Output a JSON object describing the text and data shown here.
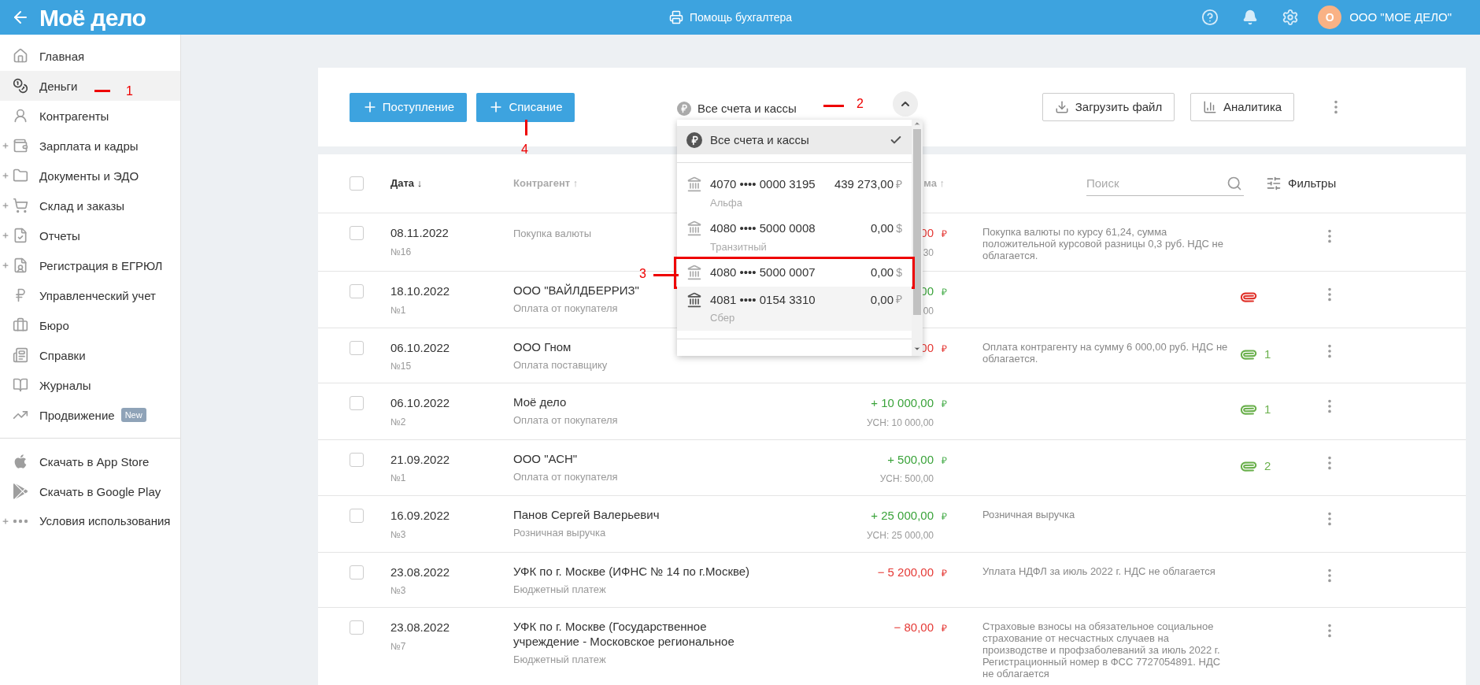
{
  "topbar": {
    "logo": "Моё дело",
    "center_link": "Помощь бухгалтера",
    "avatar_letter": "О",
    "company": "ООО \"МОЕ ДЕЛО\""
  },
  "sidebar": {
    "items": [
      {
        "label": "Главная",
        "selected": false,
        "expandable": false
      },
      {
        "label": "Деньги",
        "selected": true,
        "expandable": false
      },
      {
        "label": "Контрагенты",
        "selected": false,
        "expandable": false
      },
      {
        "label": "Зарплата и кадры",
        "selected": false,
        "expandable": true
      },
      {
        "label": "Документы и ЭДО",
        "selected": false,
        "expandable": true
      },
      {
        "label": "Склад и заказы",
        "selected": false,
        "expandable": true
      },
      {
        "label": "Отчеты",
        "selected": false,
        "expandable": true
      },
      {
        "label": "Регистрация в ЕГРЮЛ",
        "selected": false,
        "expandable": true
      },
      {
        "label": "Управленческий учет",
        "selected": false,
        "expandable": false
      },
      {
        "label": "Бюро",
        "selected": false,
        "expandable": false
      },
      {
        "label": "Справки",
        "selected": false,
        "expandable": false
      },
      {
        "label": "Журналы",
        "selected": false,
        "expandable": false
      },
      {
        "label": "Продвижение",
        "selected": false,
        "expandable": false,
        "badge": "New"
      }
    ],
    "bottom_items": [
      {
        "label": "Скачать в App Store",
        "expandable": false
      },
      {
        "label": "Скачать в Google Play",
        "expandable": false
      },
      {
        "label": "Условия использования",
        "expandable": true
      }
    ]
  },
  "toolbar": {
    "income_button": "Поступление",
    "expense_button": "Списание",
    "account_select": "Все счета и кассы",
    "upload_button": "Загрузить файл",
    "analytics_button": "Аналитика"
  },
  "table": {
    "select_all": {
      "checked": false
    },
    "columns": {
      "date": "Дата ↓",
      "counterparty": "Контрагент ↑",
      "amount": "ма ↑"
    },
    "search": {
      "placeholder": "Поиск"
    },
    "filters": "Фильтры",
    "rows": [
      {
        "checked": false,
        "date": "08.11.2022",
        "number": "№16",
        "counterparty": "",
        "purpose": "Покупка валюты",
        "kind": "expense",
        "amount": "00",
        "currency": "₽",
        "tax": "30",
        "description": "Покупка валюты по курсу 61,24, сумма положительной курсовой разницы 0,3 руб. НДС не облагается."
      },
      {
        "checked": false,
        "date": "18.10.2022",
        "number": "№1",
        "counterparty": "ООО \"ВАЙЛДБЕРРИЗ\"",
        "purpose": "Оплата от покупателя",
        "kind": "income",
        "amount": "00",
        "currency": "₽",
        "tax": "00",
        "attachment": {
          "color": "#e0322a"
        }
      },
      {
        "checked": false,
        "date": "06.10.2022",
        "number": "№15",
        "counterparty": "ООО Гном",
        "purpose": "Оплата поставщику",
        "kind": "expense",
        "amount": "00",
        "currency": "₽",
        "description": "Оплата контрагенту на сумму 6 000,00 руб. НДС не облагается.",
        "attachment": {
          "color": "#6ab04c",
          "count": "1"
        }
      },
      {
        "checked": false,
        "date": "06.10.2022",
        "number": "№2",
        "counterparty": "Моё дело",
        "purpose": "Оплата от покупателя",
        "kind": "income",
        "amount": "+ 10 000,00",
        "currency": "₽",
        "tax": "УСН: 10 000,00",
        "attachment": {
          "color": "#6ab04c",
          "count": "1"
        }
      },
      {
        "checked": false,
        "date": "21.09.2022",
        "number": "№1",
        "counterparty": "ООО \"АСН\"",
        "purpose": "Оплата от покупателя",
        "kind": "income",
        "amount": "+ 500,00",
        "currency": "₽",
        "tax": "УСН: 500,00",
        "attachment": {
          "color": "#6ab04c",
          "count": "2"
        }
      },
      {
        "checked": false,
        "date": "16.09.2022",
        "number": "№3",
        "counterparty": "Панов Сергей Валерьевич",
        "purpose": "Розничная выручка",
        "kind": "income",
        "amount": "+ 25 000,00",
        "currency": "₽",
        "tax": "УСН: 25 000,00",
        "description": "Розничная выручка"
      },
      {
        "checked": false,
        "date": "23.08.2022",
        "number": "№3",
        "counterparty": "УФК по г. Москве (ИФНС № 14 по г.Москве)",
        "purpose": "Бюджетный платеж",
        "kind": "expense",
        "amount": "− 5 200,00",
        "currency": "₽",
        "description": "Уплата НДФЛ за июль 2022 г. НДС не облагается"
      },
      {
        "checked": false,
        "date": "23.08.2022",
        "number": "№7",
        "counterparty": "УФК по г. Москве (Государственное учреждение - Московское региональное",
        "purpose": "Бюджетный платеж",
        "kind": "expense",
        "amount": "− 80,00",
        "currency": "₽",
        "description": "Страховые взносы на обязательное социальное страхование от несчастных случаев на производстве и профзаболеваний за июль 2022 г. Регистрационный номер в ФСС 7727054891. НДС не облагается"
      }
    ]
  },
  "account_dropdown": {
    "all_option": {
      "label": "Все счета и кассы",
      "selected": true
    },
    "accounts": [
      {
        "number": "4070 •••• 0000 3195",
        "balance": "439 273,00",
        "currency": "₽",
        "bank": "Альфа",
        "hovered": false,
        "boxed": false
      },
      {
        "number": "4080 •••• 5000 0008",
        "balance": "0,00",
        "currency": "$",
        "bank": "Транзитный",
        "hovered": false,
        "boxed": false
      },
      {
        "number": "4080 •••• 5000 0007",
        "balance": "0,00",
        "currency": "$",
        "hovered": false,
        "boxed": true
      },
      {
        "number": "4081 •••• 0154 3310",
        "balance": "0,00",
        "currency": "₽",
        "bank": "Сбер",
        "hovered": true,
        "boxed": false
      }
    ]
  },
  "annotations": [
    {
      "label": "1"
    },
    {
      "label": "2"
    },
    {
      "label": "3"
    },
    {
      "label": "4"
    }
  ]
}
